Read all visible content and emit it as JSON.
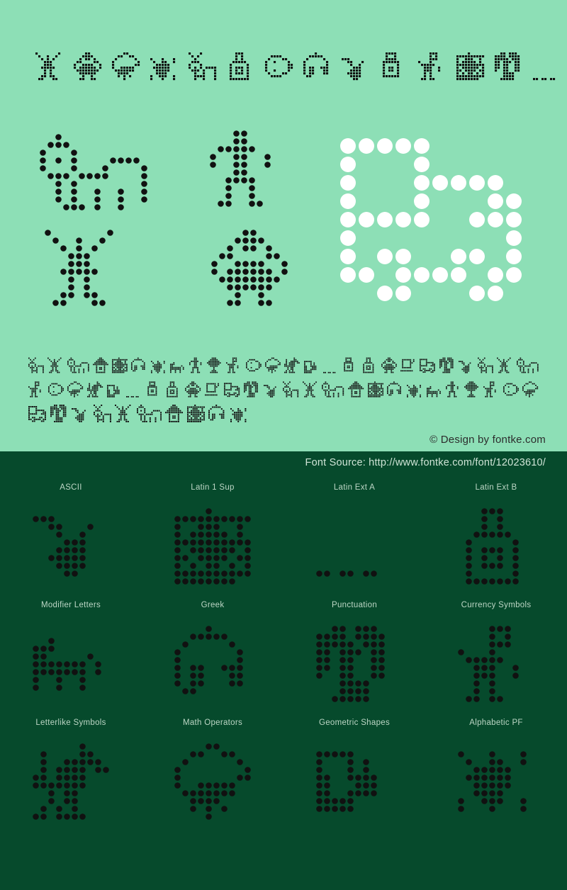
{
  "page": {
    "background_light": "#8ddfb6",
    "background_dark": "#064a2c",
    "dot_dark": "#111111",
    "dot_white": "#ffffff",
    "label_color": "#bcd6c5"
  },
  "credits": {
    "design": "© Design by fontke.com",
    "source": "Font Source: http://www.fontke.com/font/12023610/"
  },
  "title": {
    "description": "Dot-matrix pictogram font name rendered in the typeface itself",
    "glyph_count": 16
  },
  "hero": {
    "description": "Six large pictogram specimens plus one oversize white specimen",
    "cells": [
      {
        "name": "person-pushing-cart",
        "color": "dark",
        "row": 0,
        "col": 0
      },
      {
        "name": "person-and-ladder",
        "color": "dark",
        "row": 0,
        "col": 1
      },
      {
        "name": "large-cart-specimen",
        "color": "white",
        "row": 0,
        "col": 2
      },
      {
        "name": "two-figures-waving",
        "color": "dark",
        "row": 1,
        "col": 0
      },
      {
        "name": "sun-figure-and-person",
        "color": "dark",
        "row": 1,
        "col": 1
      }
    ]
  },
  "strip": {
    "description": "Full character-set specimen paragraph, three lines of small pictograms",
    "line_counts": [
      26,
      26,
      10
    ]
  },
  "unicode_ranges": {
    "rows": [
      {
        "labels_top": [
          "ASCII",
          "Latin 1 Sup",
          "Latin Ext A",
          "Latin Ext B"
        ],
        "samples": [
          "check-figure",
          "bug-shape",
          "dots-punctuation",
          "robot-figure"
        ]
      },
      {
        "labels_top": [
          "Modifier Letters",
          "Greek",
          "Punctuation",
          "Currency Symbols"
        ],
        "samples": [
          "dog-figure",
          "headphones-shape",
          "double-pillar",
          "standing-figure"
        ]
      },
      {
        "labels_top": [
          "Letterlike Symbols",
          "Math Operators",
          "Geometric Shapes",
          "Alphabetic PF"
        ],
        "samples": [
          "cat-figure",
          "balloon-shape",
          "block-letter",
          "star-figure"
        ]
      }
    ]
  },
  "glyph_bitmaps": {
    "note": "Each bitmap is an array of strings; '#' = dot on, '.' = dot off",
    "hero_person_cart": [
      "..#####........",
      ".#.....#.......",
      "#..###..#......",
      "#.#...#.#......",
      "#.#...#.#......",
      "#..###..#......",
      ".#.....#.......",
      "..#####........"
    ],
    "white_cart": [
      "#####....",
      "#...#....",
      "#...####.",
      "#...#..##",
      "#####.####",
      "#........#",
      "#.##..##.#",
      "##..####.##",
      "..##...##.."
    ]
  }
}
